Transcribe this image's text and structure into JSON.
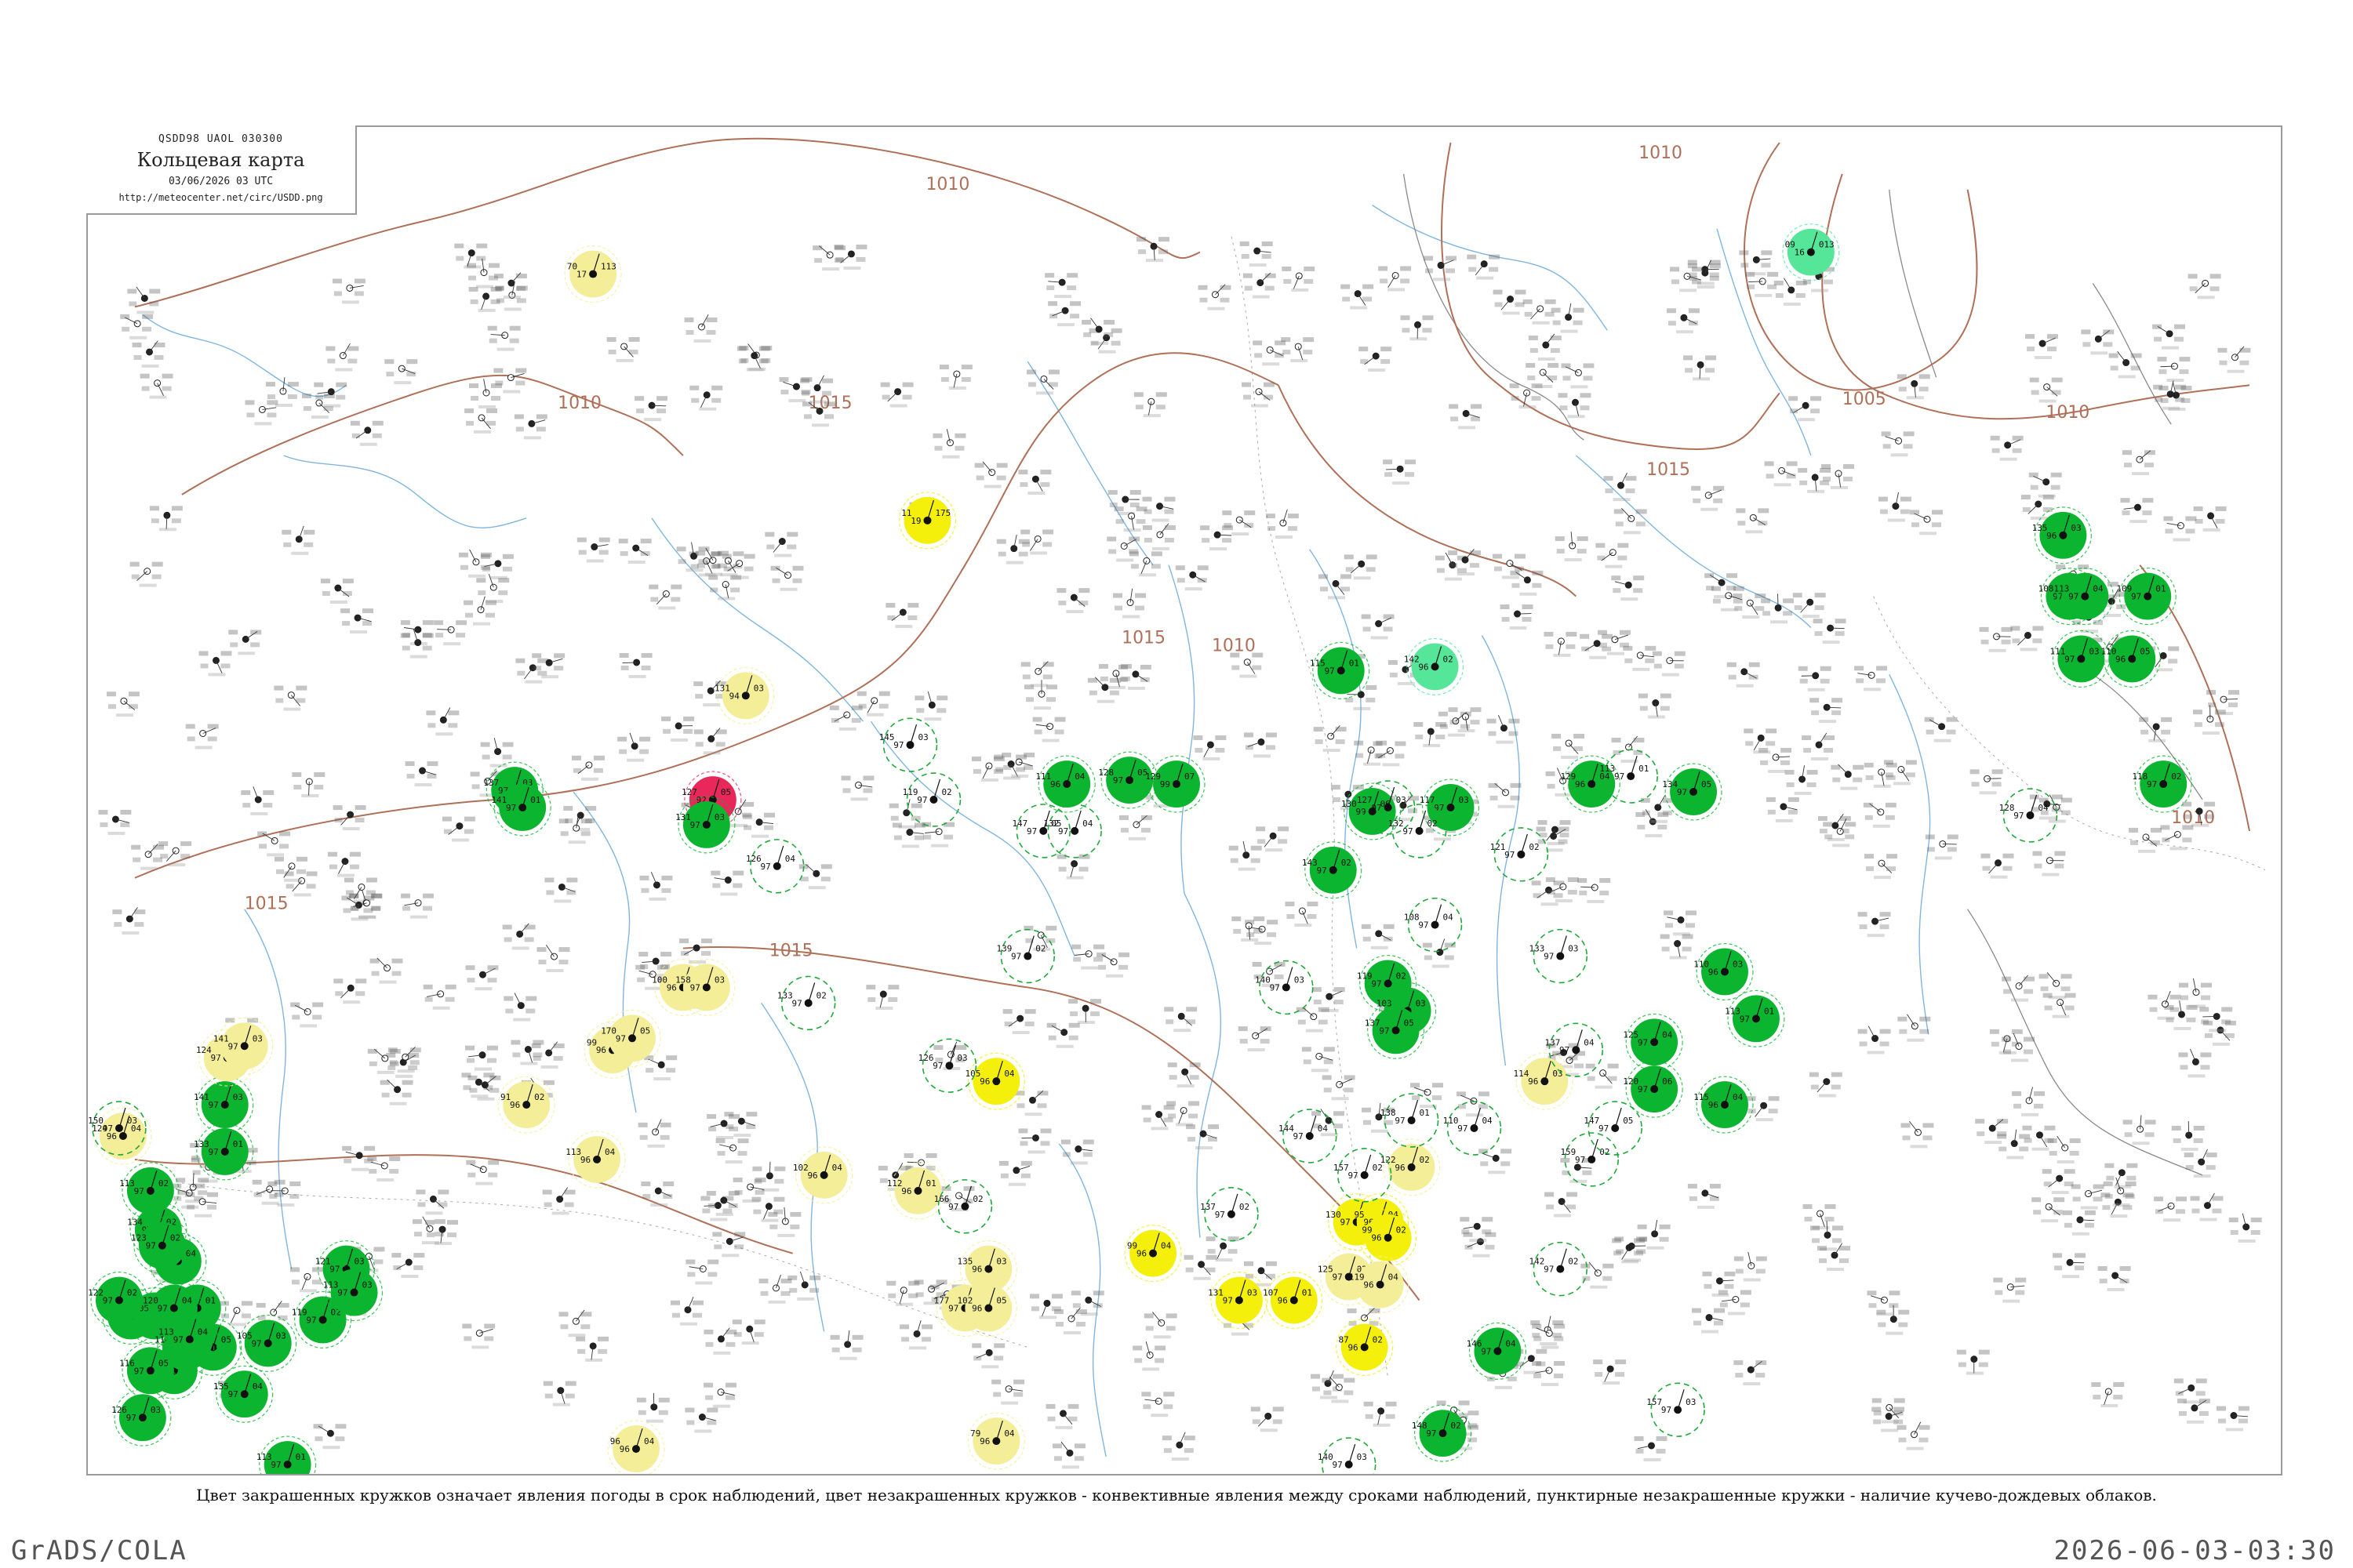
{
  "header": {
    "code_line": "QSDD98  UAOL  030300",
    "title": "Кольцевая карта",
    "date": "03/06/2026 03 UTC",
    "url": "http://meteocenter.net/circ/USDD.png"
  },
  "isobars": [
    {
      "label": "1010"
    },
    {
      "label": "1015"
    },
    {
      "label": "1005"
    }
  ],
  "stations": [
    {
      "kind": "filled",
      "color": "#f5ee99",
      "t": "70",
      "td": "17",
      "p": "113"
    },
    {
      "kind": "filled",
      "color": "#55e69a",
      "t": "09",
      "td": "16",
      "p": "013"
    },
    {
      "kind": "filled",
      "color": "#f4f00c",
      "t": "11",
      "td": "19",
      "p": "175"
    },
    {
      "kind": "filled",
      "color": "#f5ee99",
      "t": "131",
      "td": "94",
      "p": "03"
    },
    {
      "kind": "filled",
      "color": "#e8285a",
      "t": "127",
      "td": "92",
      "p": "05"
    },
    {
      "kind": "filled",
      "color": "#0bb52f",
      "t": "137",
      "td": "97",
      "p": "03"
    },
    {
      "kind": "filled",
      "color": "#0bb52f",
      "t": "141",
      "td": "97",
      "p": "01"
    },
    {
      "kind": "filled",
      "color": "#0bb52f",
      "t": "131",
      "td": "97",
      "p": "03"
    },
    {
      "kind": "filled",
      "color": "#0bb52f",
      "t": "111",
      "td": "96",
      "p": "04"
    },
    {
      "kind": "filled",
      "color": "#0bb52f",
      "t": "128",
      "td": "97",
      "p": "05"
    },
    {
      "kind": "filled",
      "color": "#0bb52f",
      "t": "129",
      "td": "99",
      "p": "07"
    },
    {
      "kind": "filled",
      "color": "#0bb52f",
      "t": "143",
      "td": "97",
      "p": "02"
    },
    {
      "kind": "filled",
      "color": "#0bb52f",
      "t": "130",
      "td": "99",
      "p": "06"
    },
    {
      "kind": "filled",
      "color": "#55e69a",
      "t": "142",
      "td": "96",
      "p": "02"
    },
    {
      "kind": "filled",
      "color": "#0bb52f",
      "t": "115",
      "td": "97",
      "p": "01"
    },
    {
      "kind": "filled",
      "color": "#0bb52f",
      "t": "117",
      "td": "97",
      "p": "03"
    },
    {
      "kind": "filled",
      "color": "#0bb52f",
      "t": "129",
      "td": "96",
      "p": "04"
    },
    {
      "kind": "filled",
      "color": "#0bb52f",
      "t": "134",
      "td": "97",
      "p": "05"
    },
    {
      "kind": "filled",
      "color": "#0bb52f",
      "t": "135",
      "td": "96",
      "p": "03"
    },
    {
      "kind": "filled",
      "color": "#0bb52f",
      "t": "108",
      "td": "97",
      "p": "02"
    },
    {
      "kind": "filled",
      "color": "#0bb52f",
      "t": "113",
      "td": "97",
      "p": "04"
    },
    {
      "kind": "filled",
      "color": "#0bb52f",
      "t": "109",
      "td": "97",
      "p": "01"
    },
    {
      "kind": "filled",
      "color": "#0bb52f",
      "t": "111",
      "td": "97",
      "p": "03"
    },
    {
      "kind": "filled",
      "color": "#0bb52f",
      "t": "110",
      "td": "96",
      "p": "05"
    },
    {
      "kind": "filled",
      "color": "#0bb52f",
      "t": "118",
      "td": "97",
      "p": "02"
    },
    {
      "kind": "filled",
      "color": "#0bb52f",
      "t": "125",
      "td": "97",
      "p": "04"
    },
    {
      "kind": "filled",
      "color": "#0bb52f",
      "t": "110",
      "td": "96",
      "p": "03"
    },
    {
      "kind": "filled",
      "color": "#0bb52f",
      "t": "113",
      "td": "97",
      "p": "01"
    },
    {
      "kind": "filled",
      "color": "#0bb52f",
      "t": "120",
      "td": "97",
      "p": "06"
    },
    {
      "kind": "filled",
      "color": "#0bb52f",
      "t": "115",
      "td": "96",
      "p": "04"
    },
    {
      "kind": "filled",
      "color": "#0bb52f",
      "t": "119",
      "td": "97",
      "p": "02"
    },
    {
      "kind": "filled",
      "color": "#0bb52f",
      "t": "103",
      "td": "97",
      "p": "03"
    },
    {
      "kind": "filled",
      "color": "#0bb52f",
      "t": "137",
      "td": "97",
      "p": "05"
    },
    {
      "kind": "filled",
      "color": "#0bb52f",
      "t": "146",
      "td": "97",
      "p": "04"
    },
    {
      "kind": "filled",
      "color": "#0bb52f",
      "t": "148",
      "td": "97",
      "p": "02"
    },
    {
      "kind": "filled",
      "color": "#0bb52f",
      "t": "128",
      "td": "97",
      "p": "04"
    },
    {
      "kind": "filled",
      "color": "#0bb52f",
      "t": "116",
      "td": "96",
      "p": "01"
    },
    {
      "kind": "filled",
      "color": "#0bb52f",
      "t": "124",
      "td": "97",
      "p": "02"
    },
    {
      "kind": "filled",
      "color": "#0bb52f",
      "t": "115",
      "td": "96",
      "p": "05"
    },
    {
      "kind": "filled",
      "color": "#0bb52f",
      "t": "105",
      "td": "97",
      "p": "03"
    },
    {
      "kind": "filled",
      "color": "#0bb52f",
      "t": "135",
      "td": "97",
      "p": "04"
    },
    {
      "kind": "filled",
      "color": "#0bb52f",
      "t": "134",
      "td": "97",
      "p": "02"
    },
    {
      "kind": "filled",
      "color": "#0bb52f",
      "t": "136",
      "td": "97",
      "p": "03"
    },
    {
      "kind": "filled",
      "color": "#0bb52f",
      "t": "134",
      "td": "97",
      "p": "05"
    },
    {
      "kind": "filled",
      "color": "#0bb52f",
      "t": "122",
      "td": "97",
      "p": "02"
    },
    {
      "kind": "filled",
      "color": "#0bb52f",
      "t": "113",
      "td": "97",
      "p": "01"
    },
    {
      "kind": "filled",
      "color": "#0bb52f",
      "t": "121",
      "td": "97",
      "p": "03"
    },
    {
      "kind": "filled",
      "color": "#0bb52f",
      "t": "119",
      "td": "97",
      "p": "02"
    },
    {
      "kind": "filled",
      "color": "#0bb52f",
      "t": "113",
      "td": "97",
      "p": "03"
    },
    {
      "kind": "filled",
      "color": "#0bb52f",
      "t": "113",
      "td": "97",
      "p": "02"
    },
    {
      "kind": "filled",
      "color": "#0bb52f",
      "t": "141",
      "td": "97",
      "p": "03"
    },
    {
      "kind": "filled",
      "color": "#0bb52f",
      "t": "133",
      "td": "97",
      "p": "01"
    },
    {
      "kind": "filled",
      "color": "#0bb52f",
      "t": "123",
      "td": "97",
      "p": "02"
    },
    {
      "kind": "filled",
      "color": "#0bb52f",
      "t": "120",
      "td": "97",
      "p": "04"
    },
    {
      "kind": "filled",
      "color": "#0bb52f",
      "t": "114",
      "td": "97",
      "p": "02"
    },
    {
      "kind": "filled",
      "color": "#0bb52f",
      "t": "116",
      "td": "97",
      "p": "05"
    },
    {
      "kind": "filled",
      "color": "#0bb52f",
      "t": "126",
      "td": "97",
      "p": "03"
    },
    {
      "kind": "filled",
      "color": "#0bb52f",
      "t": "113",
      "td": "97",
      "p": "04"
    },
    {
      "kind": "filled",
      "color": "#0bb52f",
      "t": "109",
      "td": "97",
      "p": "02"
    },
    {
      "kind": "filled",
      "color": "#f5ee99",
      "t": "124",
      "td": "97",
      "p": "02"
    },
    {
      "kind": "filled",
      "color": "#f5ee99",
      "t": "141",
      "td": "97",
      "p": "03"
    },
    {
      "kind": "filled",
      "color": "#f5ee99",
      "t": "124",
      "td": "96",
      "p": "04"
    },
    {
      "kind": "filled",
      "color": "#f5ee99",
      "t": "100",
      "td": "96",
      "p": "04"
    },
    {
      "kind": "filled",
      "color": "#f5ee99",
      "t": "158",
      "td": "97",
      "p": "03"
    },
    {
      "kind": "filled",
      "color": "#f5ee99",
      "t": "99",
      "td": "96",
      "p": "03"
    },
    {
      "kind": "filled",
      "color": "#f5ee99",
      "t": "170",
      "td": "97",
      "p": "05"
    },
    {
      "kind": "filled",
      "color": "#f5ee99",
      "t": "91",
      "td": "96",
      "p": "02"
    },
    {
      "kind": "filled",
      "color": "#f5ee99",
      "t": "113",
      "td": "96",
      "p": "04"
    },
    {
      "kind": "filled",
      "color": "#f5ee99",
      "t": "102",
      "td": "96",
      "p": "04"
    },
    {
      "kind": "filled",
      "color": "#f5ee99",
      "t": "112",
      "td": "96",
      "p": "01"
    },
    {
      "kind": "filled",
      "color": "#f5ee99",
      "t": "135",
      "td": "96",
      "p": "03"
    },
    {
      "kind": "filled",
      "color": "#f5ee99",
      "t": "177",
      "td": "97",
      "p": "02"
    },
    {
      "kind": "filled",
      "color": "#f5ee99",
      "t": "102",
      "td": "96",
      "p": "05"
    },
    {
      "kind": "filled",
      "color": "#f5ee99",
      "t": "79",
      "td": "96",
      "p": "04"
    },
    {
      "kind": "filled",
      "color": "#f5ee99",
      "t": "96",
      "td": "96",
      "p": "04"
    },
    {
      "kind": "filled",
      "color": "#f5ee99",
      "t": "125",
      "td": "97",
      "p": "02"
    },
    {
      "kind": "filled",
      "color": "#f5ee99",
      "t": "114",
      "td": "96",
      "p": "03"
    },
    {
      "kind": "filled",
      "color": "#f5ee99",
      "t": "122",
      "td": "96",
      "p": "02"
    },
    {
      "kind": "filled",
      "color": "#f4f00c",
      "t": "87",
      "td": "96",
      "p": "02"
    },
    {
      "kind": "filled",
      "color": "#f4f00c",
      "t": "105",
      "td": "96",
      "p": "04"
    },
    {
      "kind": "filled",
      "color": "#f4f00c",
      "t": "99",
      "td": "96",
      "p": "04"
    },
    {
      "kind": "filled",
      "color": "#f4f00c",
      "t": "131",
      "td": "97",
      "p": "03"
    },
    {
      "kind": "filled",
      "color": "#f4f00c",
      "t": "107",
      "td": "96",
      "p": "01"
    },
    {
      "kind": "filled",
      "color": "#f4f00c",
      "t": "130",
      "td": "97",
      "p": "02"
    },
    {
      "kind": "filled",
      "color": "#f4f00c",
      "t": "95",
      "td": "96",
      "p": "04"
    },
    {
      "kind": "filled",
      "color": "#f4f00c",
      "t": "99",
      "td": "96",
      "p": "02"
    },
    {
      "kind": "filled",
      "color": "#f5ee99",
      "t": "119",
      "td": "96",
      "p": "04"
    },
    {
      "kind": "ring",
      "color": "#1faa3a",
      "t": "150",
      "td": "97",
      "p": "03"
    },
    {
      "kind": "ring",
      "color": "#1faa3a",
      "t": "126",
      "td": "97",
      "p": "04"
    },
    {
      "kind": "ring",
      "color": "#1faa3a",
      "t": "119",
      "td": "97",
      "p": "02"
    },
    {
      "kind": "ring",
      "color": "#1faa3a",
      "t": "147",
      "td": "97",
      "p": "05"
    },
    {
      "kind": "ring",
      "color": "#1faa3a",
      "t": "140",
      "td": "97",
      "p": "03"
    },
    {
      "kind": "ring",
      "color": "#1faa3a",
      "t": "144",
      "td": "97",
      "p": "04"
    },
    {
      "kind": "ring",
      "color": "#1faa3a",
      "t": "139",
      "td": "97",
      "p": "02"
    },
    {
      "kind": "ring",
      "color": "#1faa3a",
      "t": "126",
      "td": "97",
      "p": "03"
    },
    {
      "kind": "ring",
      "color": "#1faa3a",
      "t": "157",
      "td": "97",
      "p": "02"
    },
    {
      "kind": "ring",
      "color": "#1faa3a",
      "t": "138",
      "td": "97",
      "p": "01"
    },
    {
      "kind": "ring",
      "color": "#1faa3a",
      "t": "110",
      "td": "97",
      "p": "04"
    },
    {
      "kind": "ring",
      "color": "#1faa3a",
      "t": "133",
      "td": "97",
      "p": "02"
    },
    {
      "kind": "ring",
      "color": "#1faa3a",
      "t": "145",
      "td": "97",
      "p": "03"
    },
    {
      "kind": "ring",
      "color": "#1faa3a",
      "t": "108",
      "td": "97",
      "p": "04"
    },
    {
      "kind": "ring",
      "color": "#1faa3a",
      "t": "121",
      "td": "97",
      "p": "02"
    },
    {
      "kind": "ring",
      "color": "#1faa3a",
      "t": "113",
      "td": "97",
      "p": "01"
    },
    {
      "kind": "ring",
      "color": "#1faa3a",
      "t": "133",
      "td": "97",
      "p": "03"
    },
    {
      "kind": "ring",
      "color": "#1faa3a",
      "t": "137",
      "td": "97",
      "p": "04"
    },
    {
      "kind": "ring",
      "color": "#1faa3a",
      "t": "159",
      "td": "97",
      "p": "02"
    },
    {
      "kind": "ring",
      "color": "#1faa3a",
      "t": "127",
      "td": "97",
      "p": "03"
    },
    {
      "kind": "ring",
      "color": "#1faa3a",
      "t": "132",
      "td": "97",
      "p": "02"
    },
    {
      "kind": "ring",
      "color": "#1faa3a",
      "t": "128",
      "td": "97",
      "p": "04"
    },
    {
      "kind": "ring",
      "color": "#1faa3a",
      "t": "140",
      "td": "97",
      "p": "03"
    },
    {
      "kind": "ring",
      "color": "#1faa3a",
      "t": "147",
      "td": "97",
      "p": "05"
    },
    {
      "kind": "ring",
      "color": "#1faa3a",
      "t": "137",
      "td": "97",
      "p": "02"
    },
    {
      "kind": "ring",
      "color": "#1faa3a",
      "t": "123",
      "td": "97",
      "p": "01"
    },
    {
      "kind": "ring",
      "color": "#1faa3a",
      "t": "157",
      "td": "97",
      "p": "03"
    },
    {
      "kind": "ring",
      "color": "#1faa3a",
      "t": "166",
      "td": "97",
      "p": "02"
    },
    {
      "kind": "ring",
      "color": "#1faa3a",
      "t": "132",
      "td": "97",
      "p": "04"
    },
    {
      "kind": "ring",
      "color": "#1faa3a",
      "t": "142",
      "td": "97",
      "p": "02"
    }
  ],
  "legend_note": "Цвет закрашенных кружков означает явления погоды в срок наблюдений, цвет незакрашенных кружков - конвективные явления между сроками наблюдений, пунктирные незакрашенные кружки - наличие кучево-дождевых облаков.",
  "footer": {
    "left": "GrADS/COLA",
    "right": "2026-06-03-03:30"
  },
  "colors": {
    "frame": "#9a9a9a",
    "isobar": "#b07058",
    "river": "#7fb6df",
    "border": "#aaaaaa",
    "obs_text": "#333333"
  }
}
